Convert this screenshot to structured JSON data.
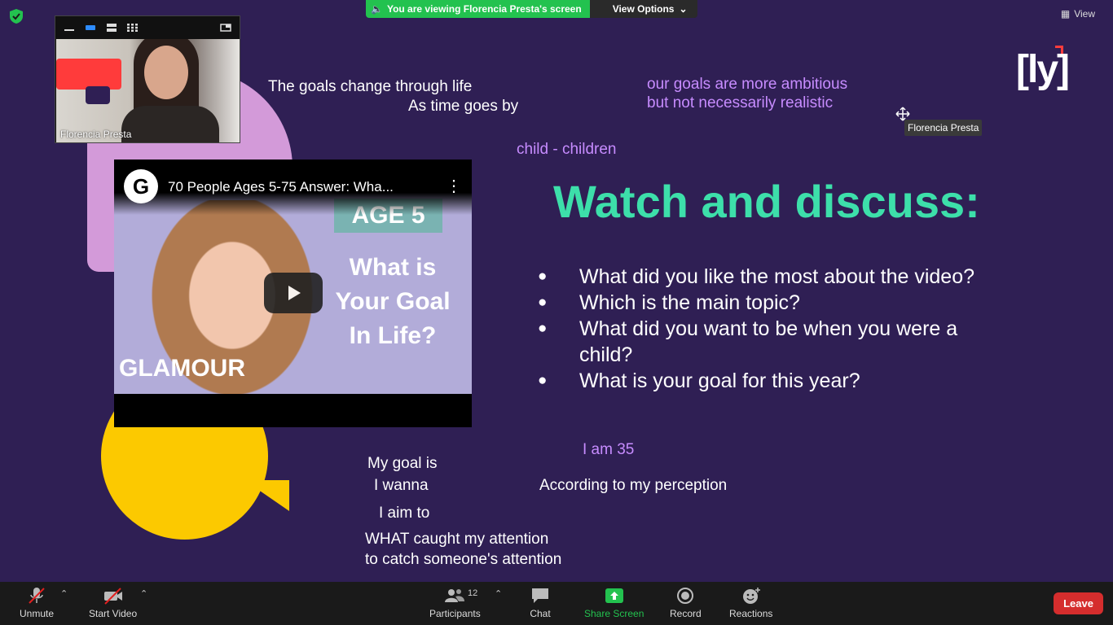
{
  "top": {
    "sharing_banner": "You are viewing Florencia Presta's screen",
    "view_options": "View Options",
    "view_button": "View"
  },
  "thumbnail": {
    "participant_name": "Florencia Presta"
  },
  "video_embed": {
    "title": "70 People Ages 5-75 Answer: Wha...",
    "channel_initial": "G",
    "age_tag": "AGE 5",
    "question": "What is Your Goal In Life?",
    "brand": "GLAMOUR"
  },
  "slide": {
    "notes_top_left_1": "The goals change through life",
    "notes_top_left_2": "As time goes by",
    "notes_top_right_1": "our goals are more ambitious",
    "notes_top_right_2": "but not necessarily realistic",
    "note_child": "child - children",
    "heading": "Watch and discuss:",
    "bullets": [
      "What did you like the most about the video?",
      "Which is the main topic?",
      "What did you want to be when you were a child?",
      "What is your goal for this  year?"
    ],
    "note_age": "I am 35",
    "note_goal_1": "My goal is",
    "note_goal_2": "I wanna",
    "note_goal_3": "I aim to",
    "note_perception": "According to my perception",
    "note_attention_1": "WHAT caught my attention",
    "note_attention_2": "to catch someone's attention",
    "logo": "[ly]"
  },
  "cursor_tooltip": "Florencia Presta",
  "toolbar": {
    "unmute": "Unmute",
    "start_video": "Start Video",
    "participants": "Participants",
    "participants_count": "12",
    "chat": "Chat",
    "share_screen": "Share Screen",
    "record": "Record",
    "reactions": "Reactions",
    "leave": "Leave"
  },
  "colors": {
    "background": "#2f1f54",
    "heading": "#3ddfaa",
    "violet_notes": "#c78cff",
    "share_green": "#23c24f",
    "leave_red": "#d52d2d",
    "yellow": "#fcc900",
    "pink": "#d39ad9"
  }
}
